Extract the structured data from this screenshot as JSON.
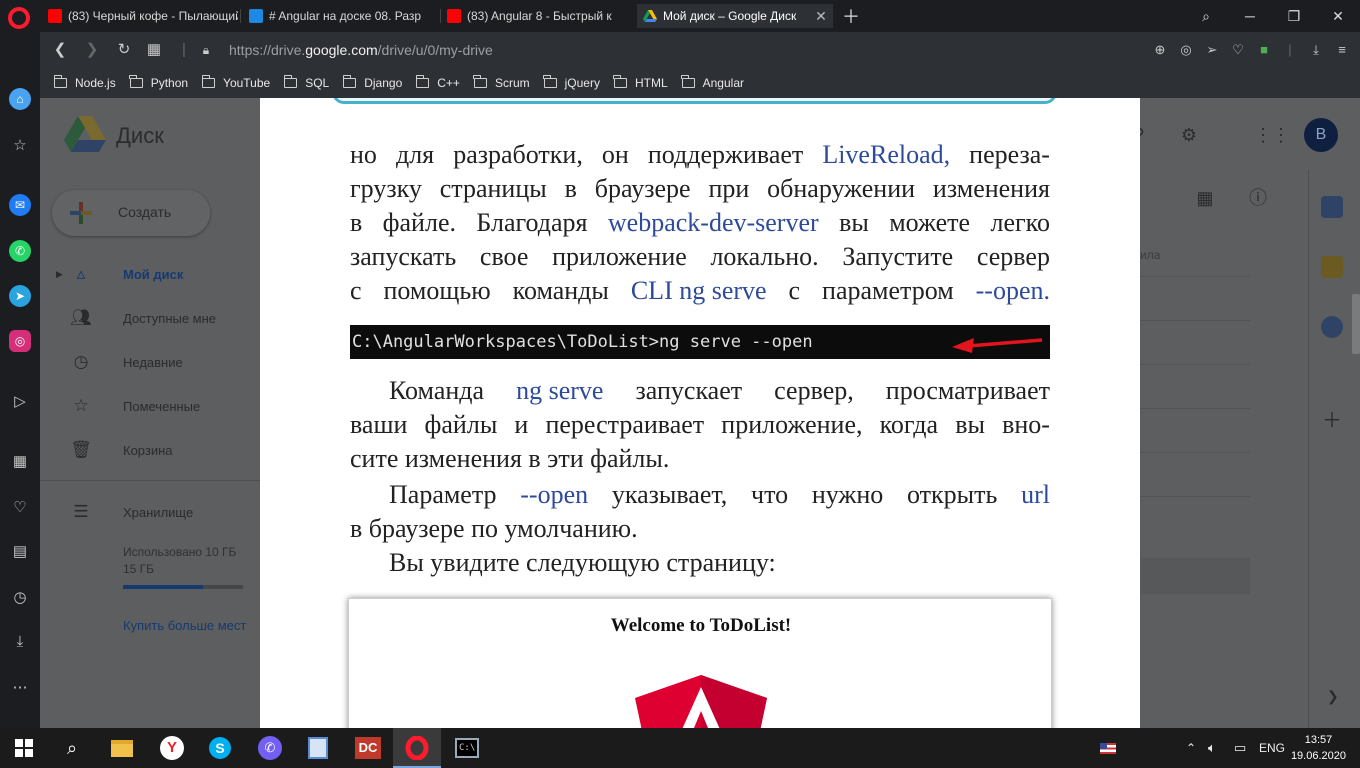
{
  "browser": {
    "tabs": [
      {
        "label": "(83) Черный кофе - Пылающий",
        "icon_color": "#ff0000"
      },
      {
        "label": "# Angular на доске 08. Разр",
        "icon_color": "#1e88e5"
      },
      {
        "label": "(83) Angular 8 - Быстрый к",
        "icon_color": "#ff0000"
      },
      {
        "label": "Мой диск – Google Диск",
        "icon_color": "#fbbc04"
      }
    ],
    "url_prefix": "https://drive.",
    "url_domain": "google.com",
    "url_path": "/drive/u/0/my-drive",
    "bookmarks": [
      "Node.js",
      "Python",
      "YouTube",
      "SQL",
      "Django",
      "C++",
      "Scrum",
      "jQuery",
      "HTML",
      "Angular"
    ]
  },
  "drive": {
    "title": "Диск",
    "create_label": "Создать",
    "nav": [
      "Мой диск",
      "Доступные мне",
      "Недавние",
      "Помеченные",
      "Корзина"
    ],
    "storage_label": "Хранилище",
    "storage_used": "Использовано 10 ГБ",
    "storage_total": "15 ГБ",
    "storage_fraction": 0.67,
    "buy_more": "Купить больше мест",
    "avatar_letter": "В",
    "column_label": "ила"
  },
  "document": {
    "paragraph1": [
      [
        "но",
        "для",
        "разработки,",
        "он",
        "поддерживает",
        "%LiveReload,",
        "переза-"
      ],
      [
        "грузку",
        "страницы",
        "в",
        "браузере",
        "при",
        "обнаружении",
        "изменения"
      ],
      [
        "в",
        "файле.",
        "Благодаря",
        "%webpack-dev-server",
        "вы",
        "можете",
        "легко"
      ],
      [
        "запускать",
        "свое",
        "приложение",
        "локально.",
        "Запустите",
        "сервер"
      ],
      [
        "с",
        "помощью",
        "команды",
        "%CLI ng serve",
        "с",
        "параметром",
        "%--open."
      ]
    ],
    "command": "C:\\AngularWorkspaces\\ToDoList>ng serve --open",
    "paragraph2": [
      [
        "      Команда",
        "%ng serve",
        "запускает",
        "сервер,",
        "просматривает"
      ],
      [
        "ваши",
        "файлы",
        "и",
        "перестраивает",
        "приложение,",
        "когда",
        "вы",
        "вно-"
      ],
      [
        "сите изменения в эти файлы."
      ]
    ],
    "paragraph3": [
      [
        "      Параметр",
        "%--open",
        "указывает,",
        "что",
        "нужно",
        "открыть",
        "%url"
      ],
      [
        "в браузере по умолчанию."
      ],
      [
        "      Вы увидите следующую страницу:"
      ]
    ],
    "screenshot_title": "Welcome to ToDoList!"
  },
  "taskbar": {
    "language": "ENG",
    "time": "13:57",
    "date": "19.06.2020"
  }
}
